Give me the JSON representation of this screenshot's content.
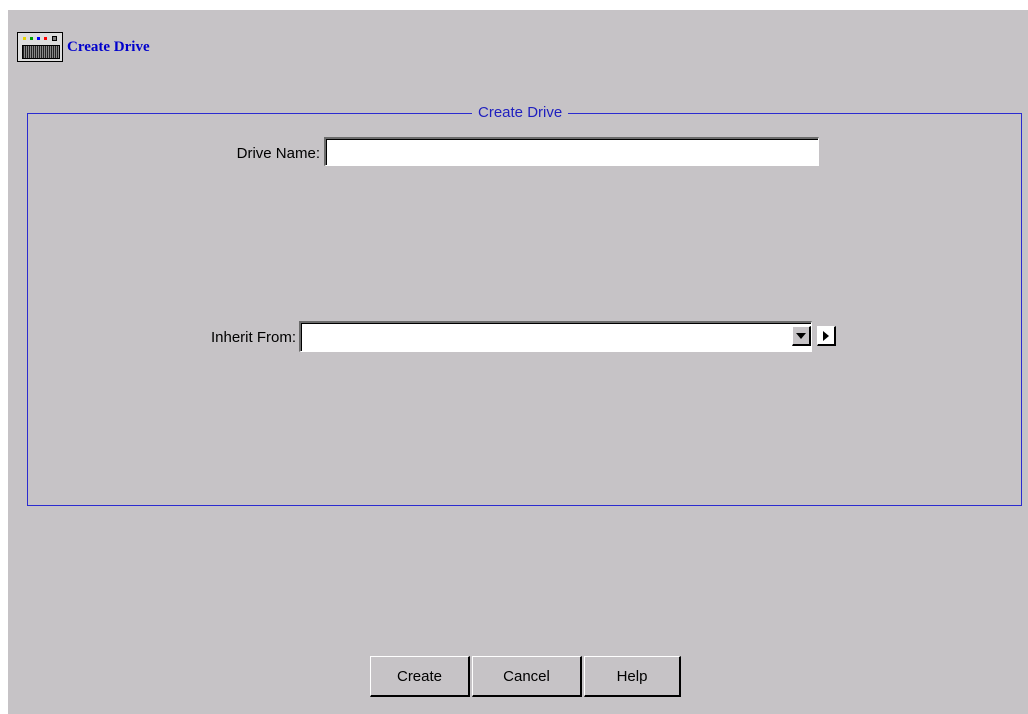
{
  "header": {
    "title": "Create Drive",
    "icon": "drive-icon"
  },
  "group": {
    "legend": "Create Drive"
  },
  "form": {
    "drive_name_label": "Drive Name:",
    "drive_name_value": "",
    "inherit_from_label": "Inherit From:",
    "inherit_from_value": ""
  },
  "buttons": {
    "create": "Create",
    "cancel": "Cancel",
    "help": "Help"
  },
  "colors": {
    "background": "#c6c3c6",
    "accent": "#0000cc"
  }
}
